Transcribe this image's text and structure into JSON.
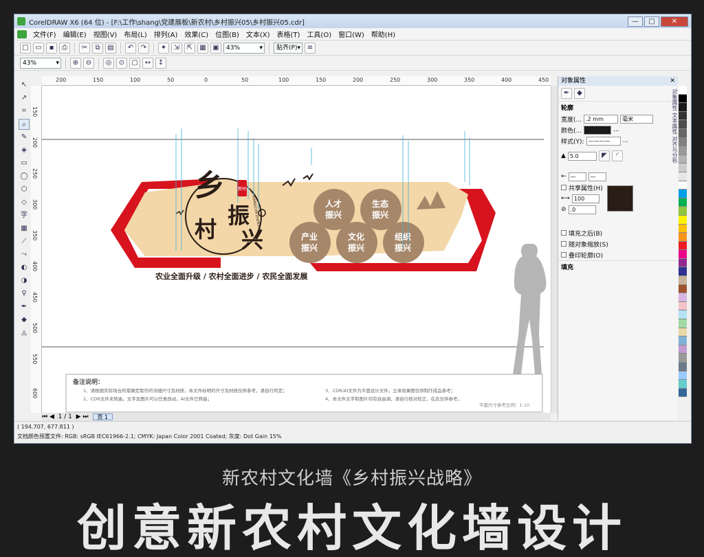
{
  "window": {
    "title": "CorelDRAW X6 (64 位) - [F:\\工作\\shang\\党建展板\\新农村\\乡村振兴05\\乡村振兴05.cdr]",
    "btn_min": "—",
    "btn_max": "□",
    "btn_close": "✕"
  },
  "menu": [
    "文件(F)",
    "编辑(E)",
    "视图(V)",
    "布局(L)",
    "排列(A)",
    "效果(C)",
    "位图(B)",
    "文本(X)",
    "表格(T)",
    "工具(O)",
    "窗口(W)",
    "帮助(H)"
  ],
  "toolbar": {
    "zoom_value": "43%",
    "snap_label": "贴齐(P)",
    "zoom2_value": "43%"
  },
  "ruler_top": [
    "200",
    "150",
    "100",
    "50",
    "0",
    "50",
    "100",
    "150",
    "200",
    "250",
    "300",
    "350",
    "400",
    "450"
  ],
  "ruler_left": [
    "600",
    "550",
    "500",
    "450",
    "400",
    "350",
    "300",
    "250",
    "200",
    "150"
  ],
  "artwork": {
    "main_chars": [
      "乡",
      "村",
      "振",
      "兴"
    ],
    "seal": "新时代",
    "pinyin": "XIANGCUN ZHENXING",
    "slogan": "农业全面升级 / 农村全面进步 / 农民全面发展",
    "circles": [
      {
        "l1": "人才",
        "l2": "振兴"
      },
      {
        "l1": "生态",
        "l2": "振兴"
      },
      {
        "l1": "产业",
        "l2": "振兴"
      },
      {
        "l1": "文化",
        "l2": "振兴"
      },
      {
        "l1": "组织",
        "l2": "振兴"
      }
    ],
    "colors": {
      "red": "#d7141e",
      "tan": "#f3d7a8",
      "brown": "#a7876a",
      "ink": "#2a1d16"
    }
  },
  "notes": {
    "title": "备注说明：",
    "items": [
      "1、请根据实际场合所需确定制作的详细尺寸及材质，本文件标明的尺寸及材质仅供参考，请自行判定；",
      "2、CDR文件未转曲，文字及图片可以任意改动，AI文件已转曲；",
      "3、CDR/AI文件为平面设计文件，立体效果图仅供制作成品参考；",
      "4、本文件文字和图片均有自由调，请自行核对校正，在此仅供参考。"
    ],
    "scale": "平面尺寸参考比例：1:10"
  },
  "page_nav": {
    "counter": "1 / 1",
    "tab": "页 1"
  },
  "status": {
    "coords": "( 194.707, 677.811 )",
    "profile": "文档颜色预置文件: RGB: sRGB IEC61966-2.1; CMYK: Japan Color 2001 Coated; 灰度: Dot Gain 15%"
  },
  "docker": {
    "title": "对象属性",
    "outline_label": "轮廓",
    "width_label": "宽度(...",
    "width_value": ".2 mm",
    "unit_value": "毫米",
    "color_label": "颜色(...",
    "style_label": "样式(Y):",
    "miter_value": "5.0",
    "share_label": "共享属性(H)",
    "stretch_value": "100",
    "angle_value": ".0",
    "fill_behind": "填充之后(B)",
    "scale_with": "随对象缩放(S)",
    "overprint": "叠印轮廓(O)",
    "fill_label": "填充",
    "more": "..."
  },
  "vtabs": "对象属性 文本属性 对齐与分布",
  "footer": {
    "subtitle": "新农村文化墙《乡村振兴战略》",
    "big": "创意新农村文化墙设计"
  },
  "palette": [
    "#ffffff",
    "#000000",
    "#1a1a1a",
    "#333333",
    "#4d4d4d",
    "#666666",
    "#808080",
    "#999999",
    "#b3b3b3",
    "#cccccc",
    "#e6e6e6",
    "#ffffff",
    "#00a0e9",
    "#00b050",
    "#8dc63f",
    "#fff200",
    "#ffc000",
    "#f7941d",
    "#ed1c24",
    "#ec008c",
    "#92278f",
    "#2e3192",
    "#c7b299",
    "#a0522d",
    "#d8b4e2",
    "#f5c2c7",
    "#b5e3f5",
    "#a3d9a5",
    "#e9d8a6",
    "#7fb3d5",
    "#c39bd3",
    "#999999",
    "#6c7a89",
    "#99ccff",
    "#66cccc",
    "#336699"
  ]
}
